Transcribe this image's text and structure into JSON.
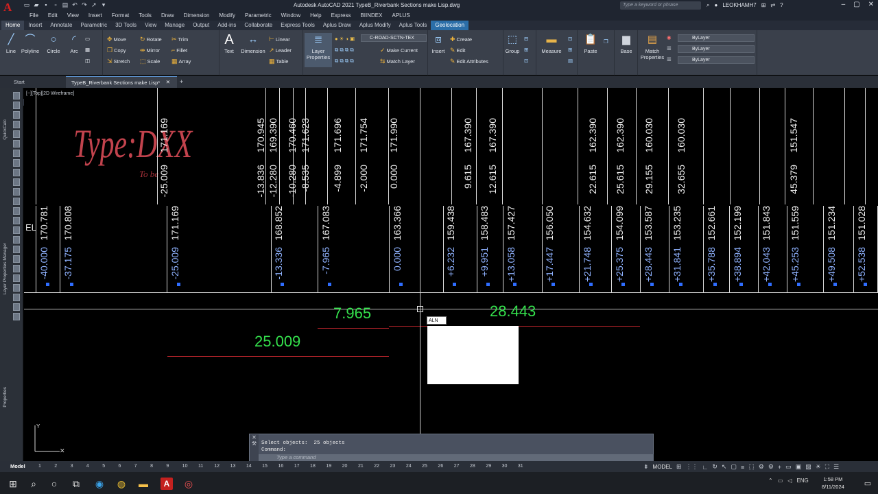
{
  "title": "Autodesk AutoCAD 2021    TypeB_Riverbank Sections make Lisp.dwg",
  "search_placeholder": "Type a keyword or phrase",
  "user": "LEOKHAMH7",
  "menus": [
    "File",
    "Edit",
    "View",
    "Insert",
    "Format",
    "Tools",
    "Draw",
    "Dimension",
    "Modify",
    "Parametric",
    "Window",
    "Help",
    "Express",
    "BIINDEX",
    "APLUS"
  ],
  "ribbon_tabs": [
    "Home",
    "Insert",
    "Annotate",
    "Parametric",
    "3D Tools",
    "View",
    "Manage",
    "Output",
    "Add-ins",
    "Collaborate",
    "Express Tools",
    "Aplus Draw",
    "Aplus Modify",
    "Aplus Tools",
    "Geolocation"
  ],
  "ribbon": {
    "line": "Line",
    "polyline": "Polyline",
    "circle": "Circle",
    "arc": "Arc",
    "move": "Move",
    "rotate": "Rotate",
    "trim": "Trim",
    "copy": "Copy",
    "mirror": "Mirror",
    "fillet": "Fillet",
    "stretch": "Stretch",
    "scale": "Scale",
    "array": "Array",
    "text": "Text",
    "dimension": "Dimension",
    "linear": "Linear",
    "leader": "Leader",
    "table": "Table",
    "layer_properties": "Layer Properties",
    "layer_name": "C-ROAD-SCTN-TEX",
    "make_current": "Make Current",
    "match_layer": "Match Layer",
    "insert": "Insert",
    "create": "Create",
    "edit": "Edit",
    "edit_attributes": "Edit Attributes",
    "group": "Group",
    "measure": "Measure",
    "paste": "Paste",
    "base": "Base",
    "match_properties": "Match Properties",
    "bylayer1": "ByLayer",
    "bylayer2": "ByLayer",
    "bylayer3": "ByLayer"
  },
  "tabs": {
    "start": "Start",
    "doc": "TypeB_Riverbank Sections make Lisp*"
  },
  "view_label": "[−][Top][2D Wireframe]",
  "palette_labels": {
    "quickcalc": "QuickCalc",
    "layer_manager": "Layer Properties Manager",
    "properties": "Properties"
  },
  "drawing": {
    "type_label": "Type:DXX",
    "to_be": "To be",
    "el_label": "EL",
    "top_row": [
      {
        "off": "-25.009",
        "elev": "171.169"
      },
      {
        "off": "-13.836",
        "elev": "170.945"
      },
      {
        "off": "-12.280",
        "elev": "169.390"
      },
      {
        "off": "-10.280",
        "elev": "170.460"
      },
      {
        "off": "-8.535",
        "elev": "171.623"
      },
      {
        "off": "-4.899",
        "elev": "171.696"
      },
      {
        "off": "-2.000",
        "elev": "171.754"
      },
      {
        "off": "0.000",
        "elev": "171.990"
      },
      {
        "off": "9.615",
        "elev": "167.390"
      },
      {
        "off": "12.615",
        "elev": "167.390"
      },
      {
        "off": "22.615",
        "elev": "162.390"
      },
      {
        "off": "25.615",
        "elev": "162.390"
      },
      {
        "off": "29.155",
        "elev": "160.030"
      },
      {
        "off": "32.655",
        "elev": "160.030"
      },
      {
        "off": "45.379",
        "elev": "151.547"
      }
    ],
    "bottom_row": [
      {
        "off": "-40.000",
        "elev": "170.781"
      },
      {
        "off": "-37.175",
        "elev": "170.808"
      },
      {
        "off": "-25.009",
        "elev": "171.169"
      },
      {
        "off": "-13.336",
        "elev": "168.852"
      },
      {
        "off": "-7.965",
        "elev": "167.083"
      },
      {
        "off": "0.000",
        "elev": "163.366"
      },
      {
        "off": "+6.232",
        "elev": "159.438"
      },
      {
        "off": "+9.951",
        "elev": "158.483"
      },
      {
        "off": "+13.058",
        "elev": "157.427"
      },
      {
        "off": "+17.447",
        "elev": "156.050"
      },
      {
        "off": "+21.748",
        "elev": "154.632"
      },
      {
        "off": "+25.375",
        "elev": "154.099"
      },
      {
        "off": "+28.443",
        "elev": "153.587"
      },
      {
        "off": "+31.841",
        "elev": "153.235"
      },
      {
        "off": "+35.788",
        "elev": "152.661"
      },
      {
        "off": "+38.894",
        "elev": "152.199"
      },
      {
        "off": "+42.043",
        "elev": "151.843"
      },
      {
        "off": "+45.253",
        "elev": "151.559"
      },
      {
        "off": "+49.508",
        "elev": "151.234"
      },
      {
        "off": "+52.538",
        "elev": "151.028"
      }
    ],
    "dim1": "7.965",
    "dim2": "28.443",
    "dim3": "25.009",
    "aln_input": "ALN"
  },
  "command": {
    "history1": "Select objects:  25 objects",
    "history2": "Command:",
    "placeholder": "Type a command"
  },
  "status": {
    "model": "Model",
    "layouts": [
      "1",
      "2",
      "3",
      "4",
      "5",
      "6",
      "7",
      "8",
      "9",
      "10",
      "11",
      "12",
      "13",
      "14",
      "15",
      "16",
      "17",
      "18",
      "19",
      "20",
      "21",
      "22",
      "23",
      "24",
      "25",
      "26",
      "27",
      "28",
      "29",
      "30",
      "31"
    ],
    "space": "MODEL"
  },
  "taskbar": {
    "lang": "ENG",
    "time": "1:58 PM",
    "date": "8/11/2024"
  }
}
